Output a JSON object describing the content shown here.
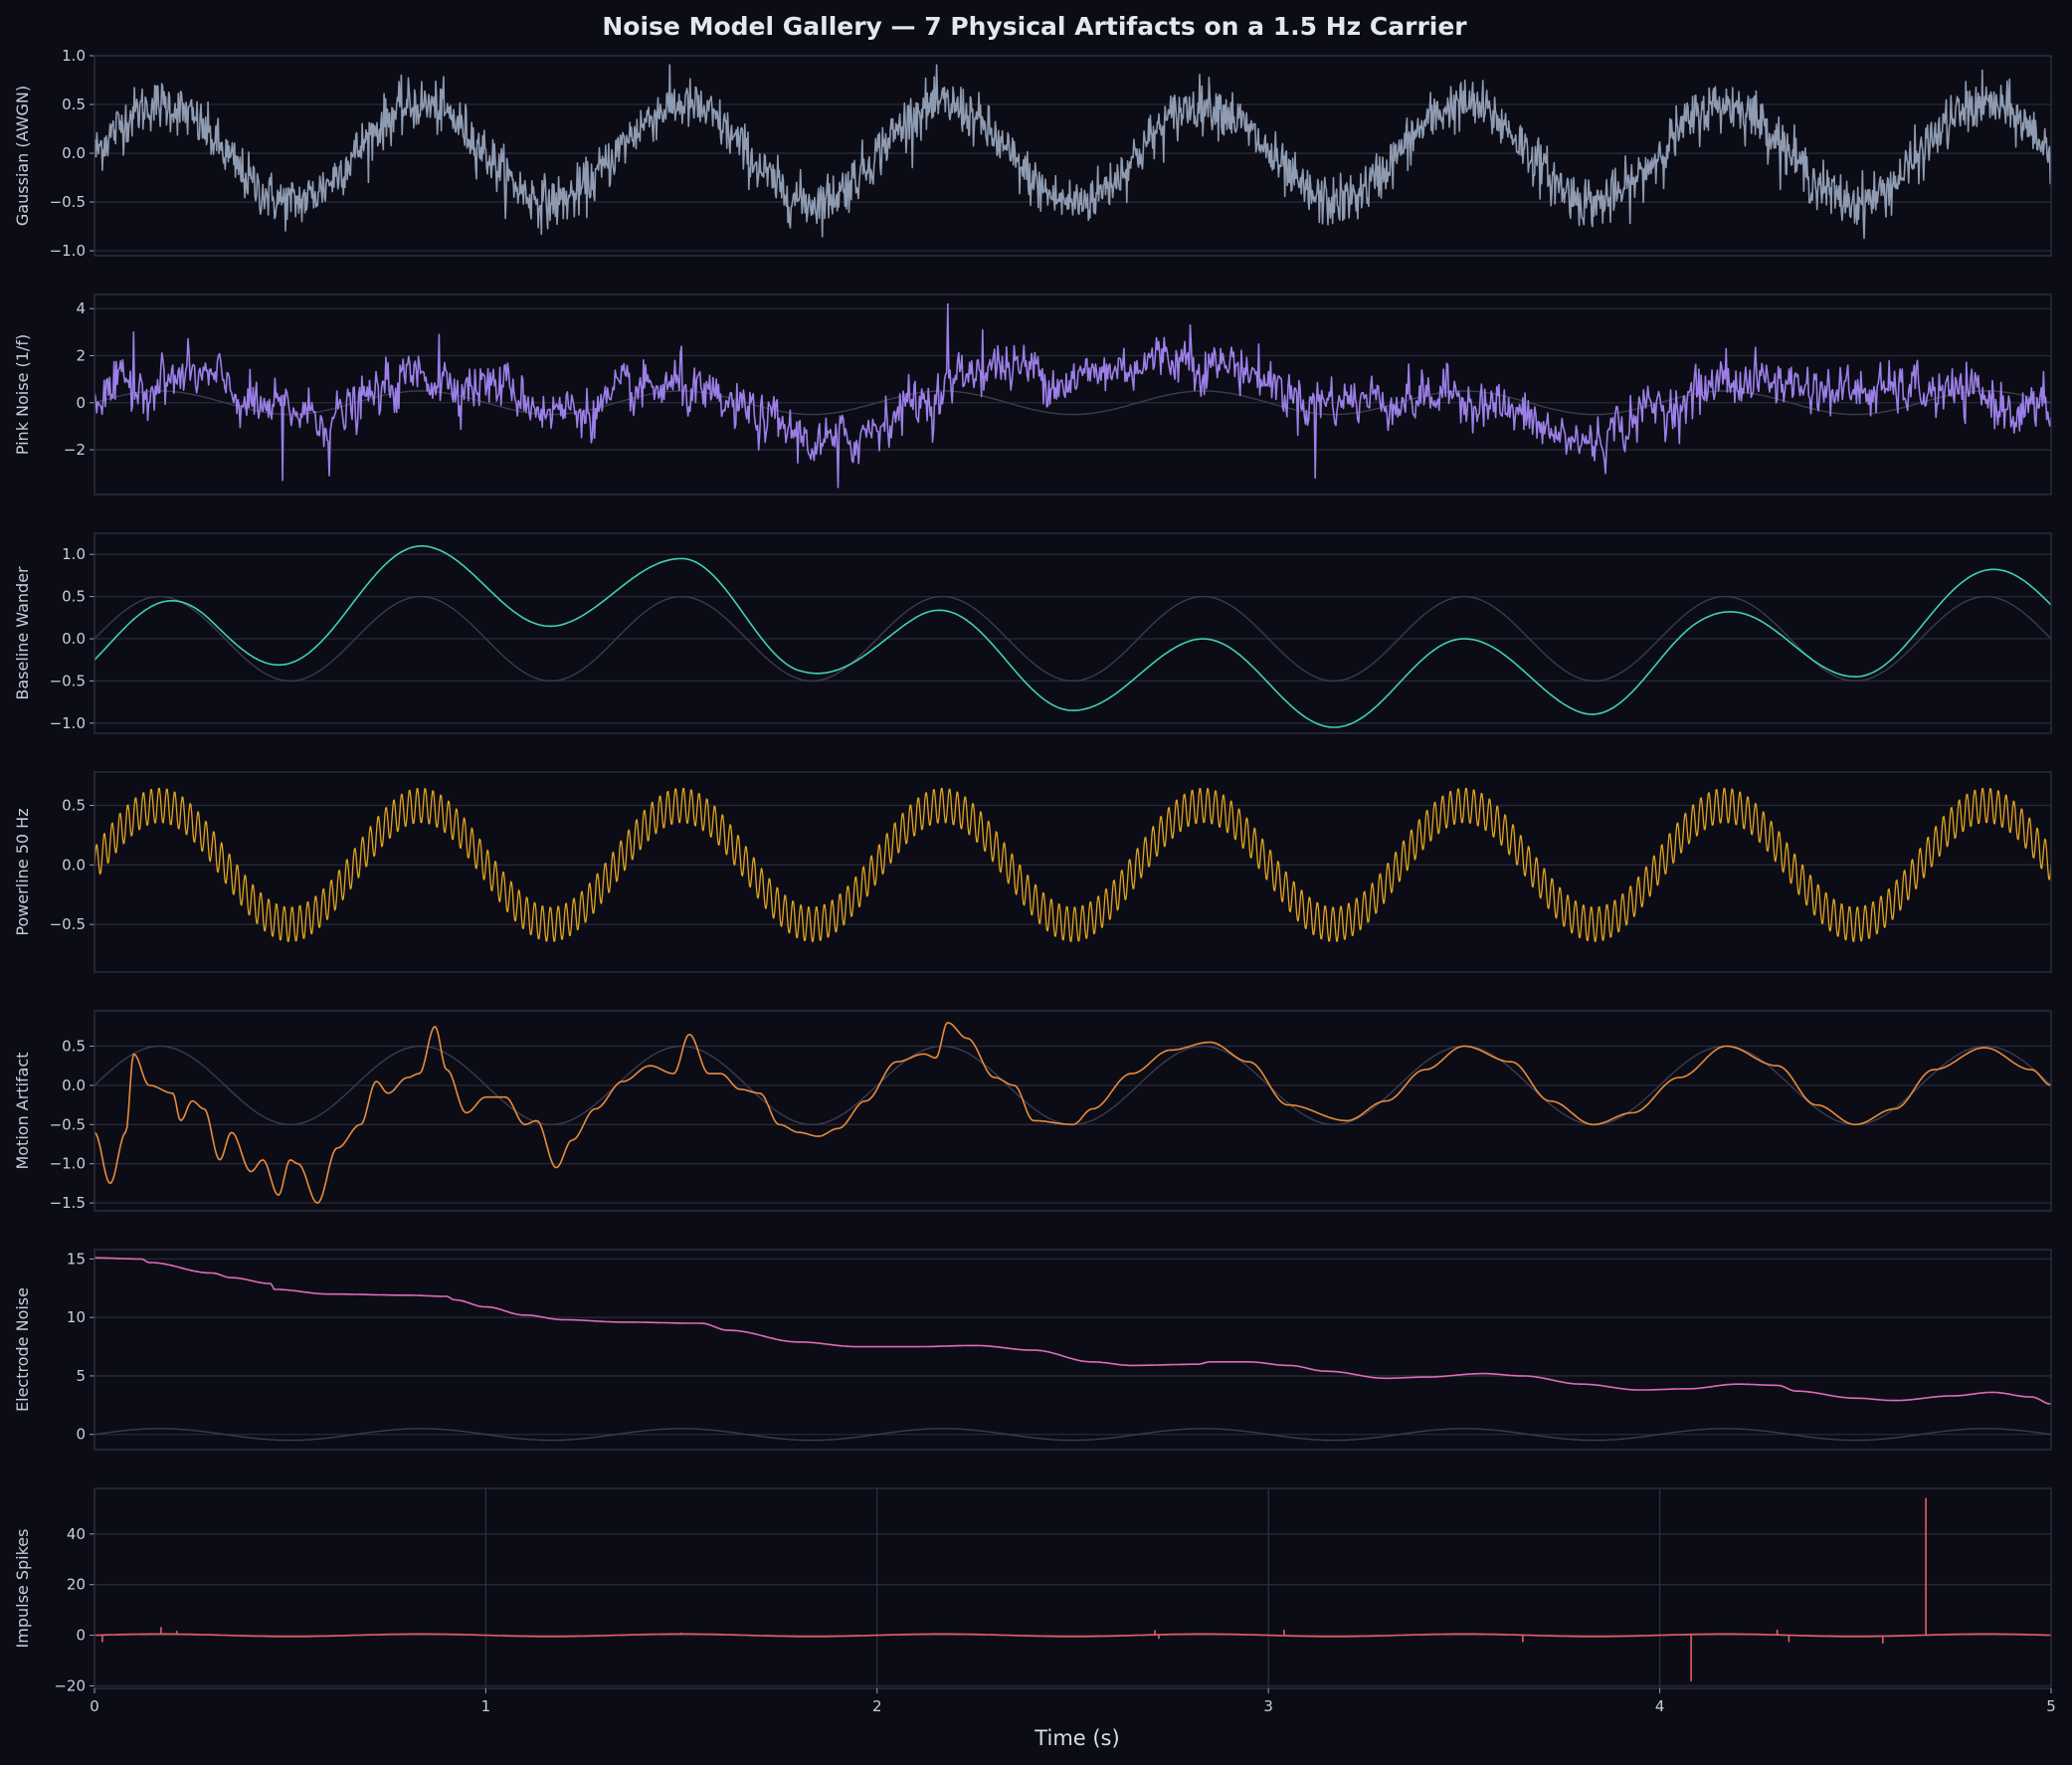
{
  "chart_data": {
    "type": "line",
    "title": "Noise Model Gallery — 7 Physical Artifacts on a 1.5 Hz Carrier",
    "xlabel": "Time (s)",
    "xlim": [
      0,
      5
    ],
    "xticks": [
      "0",
      "1",
      "2",
      "3",
      "4",
      "5"
    ],
    "carrier": {
      "frequency_hz": 1.5,
      "amplitude": 0.5,
      "color": "#3a3c4e"
    },
    "panels": [
      {
        "ylabel": "Gaussian (AWGN)",
        "color": "#8e9bb0",
        "ylim": [
          -1.05,
          1.0
        ],
        "yticks": [
          1.0,
          0.5,
          0.0,
          -0.5,
          -1.0
        ],
        "ytick_labels": [
          "1.0",
          "0.5",
          "0.0",
          "−0.5",
          "−1.0"
        ],
        "show_carrier": false,
        "noise": {
          "kind": "gaussian",
          "std": 0.13,
          "carrier_amp": 0.5
        }
      },
      {
        "ylabel": "Pink Noise (1/f)",
        "color": "#9b7fe6",
        "ylim": [
          -3.9,
          4.6
        ],
        "yticks": [
          4,
          2,
          0,
          -2
        ],
        "ytick_labels": [
          "4",
          "2",
          "0",
          "−2"
        ],
        "show_carrier": true,
        "drift": [
          [
            0,
            0.3
          ],
          [
            0.25,
            1.0
          ],
          [
            0.45,
            -0.3
          ],
          [
            0.6,
            -0.5
          ],
          [
            0.85,
            1.0
          ],
          [
            1.0,
            0.9
          ],
          [
            1.2,
            -0.2
          ],
          [
            1.5,
            0.4
          ],
          [
            1.6,
            -0.4
          ],
          [
            1.9,
            -1.7
          ],
          [
            2.1,
            0.0
          ],
          [
            2.3,
            1.6
          ],
          [
            2.5,
            1.2
          ],
          [
            2.75,
            1.9
          ],
          [
            2.9,
            1.6
          ],
          [
            3.1,
            0.3
          ],
          [
            3.5,
            0.2
          ],
          [
            3.8,
            -1.6
          ],
          [
            4.0,
            -0.2
          ],
          [
            4.2,
            0.9
          ],
          [
            4.6,
            0.5
          ],
          [
            5.0,
            -0.4
          ]
        ],
        "noise": {
          "kind": "pink",
          "std": 0.55,
          "carrier_amp": 0.5
        },
        "peaks": [
          [
            0.1,
            3.0
          ],
          [
            0.88,
            2.9
          ],
          [
            1.5,
            2.4
          ],
          [
            2.18,
            4.2
          ],
          [
            2.27,
            3.1
          ],
          [
            2.8,
            3.3
          ],
          [
            3.12,
            -3.2
          ],
          [
            4.17,
            2.3
          ],
          [
            0.48,
            -3.3
          ],
          [
            0.6,
            -3.1
          ],
          [
            1.9,
            -3.6
          ]
        ]
      },
      {
        "ylabel": "Baseline Wander",
        "color": "#3fd2b0",
        "ylim": [
          -1.12,
          1.25
        ],
        "yticks": [
          1.0,
          0.5,
          0.0,
          -0.5,
          -1.0
        ],
        "ytick_labels": [
          "1.0",
          "0.5",
          "0.0",
          "−0.5",
          "−1.0"
        ],
        "show_carrier": true,
        "drift": [
          [
            0,
            -0.25
          ],
          [
            0.3,
            0.05
          ],
          [
            0.85,
            0.6
          ],
          [
            1.2,
            0.65
          ],
          [
            1.5,
            0.45
          ],
          [
            1.8,
            0.1
          ],
          [
            2.1,
            -0.15
          ],
          [
            2.5,
            -0.35
          ],
          [
            2.8,
            -0.5
          ],
          [
            3.2,
            -0.55
          ],
          [
            3.5,
            -0.5
          ],
          [
            3.8,
            -0.4
          ],
          [
            4.1,
            -0.2
          ],
          [
            4.5,
            0.05
          ],
          [
            5.0,
            0.4
          ]
        ],
        "noise": {
          "kind": "none",
          "std": 0,
          "carrier_amp": 0.5
        }
      },
      {
        "ylabel": "Powerline 50 Hz",
        "color": "#e0a21d",
        "ylim": [
          -0.9,
          0.78
        ],
        "yticks": [
          0.5,
          0.0,
          -0.5
        ],
        "ytick_labels": [
          "0.5",
          "0.0",
          "−0.5"
        ],
        "show_carrier": false,
        "noise": {
          "kind": "powerline",
          "line_hz": 50,
          "line_amp": 0.15,
          "carrier_amp": 0.5
        }
      },
      {
        "ylabel": "Motion Artifact",
        "color": "#e88b3a",
        "ylim": [
          -1.6,
          0.95
        ],
        "yticks": [
          0.5,
          0.0,
          -0.5,
          -1.0,
          -1.5
        ],
        "ytick_labels": [
          "0.5",
          "0.0",
          "−0.5",
          "−1.0",
          "−1.5"
        ],
        "show_carrier": true,
        "points": [
          [
            0,
            -0.6
          ],
          [
            0.04,
            -1.25
          ],
          [
            0.08,
            -0.6
          ],
          [
            0.1,
            0.4
          ],
          [
            0.14,
            0.0
          ],
          [
            0.2,
            -0.1
          ],
          [
            0.22,
            -0.45
          ],
          [
            0.25,
            -0.2
          ],
          [
            0.28,
            -0.3
          ],
          [
            0.32,
            -0.95
          ],
          [
            0.35,
            -0.6
          ],
          [
            0.4,
            -1.1
          ],
          [
            0.43,
            -0.95
          ],
          [
            0.47,
            -1.4
          ],
          [
            0.5,
            -0.95
          ],
          [
            0.52,
            -1.0
          ],
          [
            0.57,
            -1.5
          ],
          [
            0.62,
            -0.8
          ],
          [
            0.68,
            -0.5
          ],
          [
            0.72,
            0.05
          ],
          [
            0.75,
            -0.1
          ],
          [
            0.8,
            0.1
          ],
          [
            0.83,
            0.15
          ],
          [
            0.87,
            0.75
          ],
          [
            0.9,
            0.2
          ],
          [
            0.95,
            -0.35
          ],
          [
            1.0,
            -0.15
          ],
          [
            1.05,
            -0.15
          ],
          [
            1.1,
            -0.5
          ],
          [
            1.13,
            -0.45
          ],
          [
            1.18,
            -1.05
          ],
          [
            1.22,
            -0.7
          ],
          [
            1.28,
            -0.3
          ],
          [
            1.35,
            0.05
          ],
          [
            1.42,
            0.25
          ],
          [
            1.48,
            0.15
          ],
          [
            1.52,
            0.65
          ],
          [
            1.57,
            0.15
          ],
          [
            1.6,
            0.15
          ],
          [
            1.65,
            -0.05
          ],
          [
            1.7,
            -0.1
          ],
          [
            1.75,
            -0.5
          ],
          [
            1.8,
            -0.6
          ],
          [
            1.85,
            -0.65
          ],
          [
            1.9,
            -0.55
          ],
          [
            1.97,
            -0.2
          ],
          [
            2.05,
            0.3
          ],
          [
            2.12,
            0.4
          ],
          [
            2.15,
            0.35
          ],
          [
            2.18,
            0.8
          ],
          [
            2.23,
            0.6
          ],
          [
            2.3,
            0.1
          ],
          [
            2.35,
            0.0
          ],
          [
            2.4,
            -0.45
          ],
          [
            2.5,
            -0.5
          ],
          [
            2.55,
            -0.3
          ],
          [
            2.65,
            0.15
          ],
          [
            2.75,
            0.45
          ],
          [
            2.85,
            0.55
          ],
          [
            2.95,
            0.3
          ],
          [
            3.05,
            -0.25
          ],
          [
            3.2,
            -0.45
          ],
          [
            3.3,
            -0.2
          ],
          [
            3.4,
            0.2
          ],
          [
            3.5,
            0.5
          ],
          [
            3.62,
            0.3
          ],
          [
            3.72,
            -0.2
          ],
          [
            3.83,
            -0.5
          ],
          [
            3.93,
            -0.35
          ],
          [
            4.05,
            0.1
          ],
          [
            4.17,
            0.5
          ],
          [
            4.3,
            0.25
          ],
          [
            4.4,
            -0.25
          ],
          [
            4.5,
            -0.5
          ],
          [
            4.6,
            -0.3
          ],
          [
            4.7,
            0.2
          ],
          [
            4.83,
            0.48
          ],
          [
            4.95,
            0.2
          ],
          [
            5.0,
            0.0
          ]
        ]
      },
      {
        "ylabel": "Electrode Noise",
        "color": "#e06bb6",
        "ylim": [
          -1.3,
          15.8
        ],
        "yticks": [
          15,
          10,
          5,
          0
        ],
        "ytick_labels": [
          "15",
          "10",
          "5",
          "0"
        ],
        "show_carrier": true,
        "points": [
          [
            0,
            15.1
          ],
          [
            0.12,
            15.0
          ],
          [
            0.14,
            14.7
          ],
          [
            0.3,
            13.8
          ],
          [
            0.35,
            13.4
          ],
          [
            0.45,
            12.9
          ],
          [
            0.46,
            12.4
          ],
          [
            0.6,
            12.0
          ],
          [
            0.8,
            11.9
          ],
          [
            0.9,
            11.8
          ],
          [
            0.92,
            11.5
          ],
          [
            1.0,
            10.9
          ],
          [
            1.1,
            10.2
          ],
          [
            1.2,
            9.8
          ],
          [
            1.35,
            9.6
          ],
          [
            1.55,
            9.5
          ],
          [
            1.62,
            8.9
          ],
          [
            1.8,
            7.9
          ],
          [
            1.95,
            7.5
          ],
          [
            2.1,
            7.5
          ],
          [
            2.25,
            7.6
          ],
          [
            2.4,
            7.2
          ],
          [
            2.55,
            6.2
          ],
          [
            2.65,
            5.9
          ],
          [
            2.82,
            6.0
          ],
          [
            2.85,
            6.2
          ],
          [
            2.95,
            6.2
          ],
          [
            3.05,
            5.9
          ],
          [
            3.15,
            5.4
          ],
          [
            3.3,
            4.8
          ],
          [
            3.4,
            4.9
          ],
          [
            3.55,
            5.2
          ],
          [
            3.65,
            5.0
          ],
          [
            3.8,
            4.3
          ],
          [
            3.95,
            3.8
          ],
          [
            4.07,
            3.9
          ],
          [
            4.2,
            4.3
          ],
          [
            4.3,
            4.2
          ],
          [
            4.35,
            3.7
          ],
          [
            4.5,
            3.1
          ],
          [
            4.6,
            2.9
          ],
          [
            4.75,
            3.3
          ],
          [
            4.85,
            3.6
          ],
          [
            4.95,
            3.2
          ],
          [
            5.0,
            2.6
          ]
        ]
      },
      {
        "ylabel": "Impulse Spikes",
        "color": "#e25f62",
        "ylim": [
          -21,
          58
        ],
        "yticks": [
          40,
          20,
          0,
          -20
        ],
        "ytick_labels": [
          "40",
          "20",
          "0",
          "−20"
        ],
        "show_carrier": false,
        "vgrid": true,
        "spikes": [
          [
            0.02,
            -2.5
          ],
          [
            0.17,
            3.0
          ],
          [
            0.21,
            1.5
          ],
          [
            1.5,
            0.8
          ],
          [
            2.71,
            1.8
          ],
          [
            2.72,
            -1.2
          ],
          [
            3.04,
            2.0
          ],
          [
            3.65,
            -2.5
          ],
          [
            4.08,
            -18.0
          ],
          [
            4.3,
            2.0
          ],
          [
            4.33,
            -2.5
          ],
          [
            4.57,
            -3.0
          ],
          [
            4.68,
            54.0
          ]
        ]
      }
    ]
  }
}
